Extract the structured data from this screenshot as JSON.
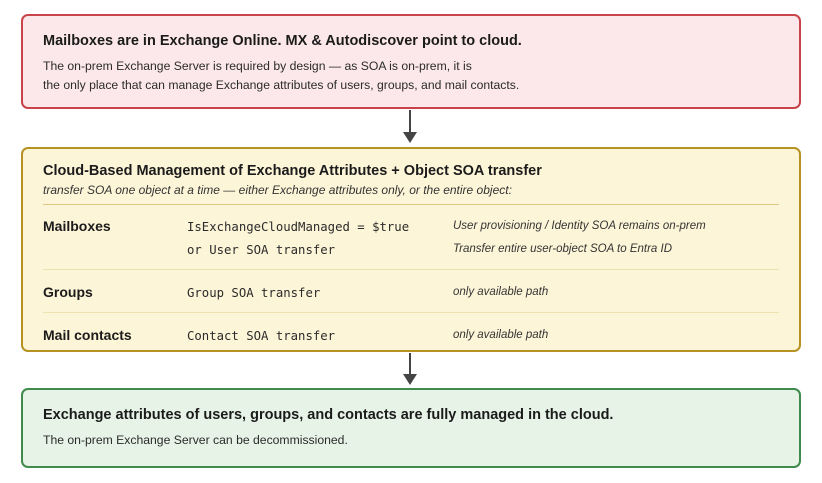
{
  "top_box": {
    "heading": "Mailboxes are in Exchange Online. MX & Autodiscover point to cloud.",
    "body_line1": "The on-prem Exchange Server is required by design — as SOA is on-prem, it is",
    "body_line2": "the only place that can manage Exchange attributes of users, groups, and mail contacts."
  },
  "middle_box": {
    "heading": "Cloud-Based Management of Exchange Attributes + Object SOA transfer",
    "subtitle": "transfer SOA one object at a time — either Exchange attributes only, or the entire object:",
    "rows": [
      {
        "label": "Mailboxes",
        "code_line1": "IsExchangeCloudManaged = $true",
        "code_line2": "or User SOA transfer",
        "note_line1": "User provisioning / Identity SOA remains on-prem",
        "note_line2": "Transfer entire user-object SOA to Entra ID"
      },
      {
        "label": "Groups",
        "code": "Group SOA transfer",
        "note": "only available path"
      },
      {
        "label": "Mail contacts",
        "code": "Contact SOA transfer",
        "note": "only available path"
      }
    ]
  },
  "bottom_box": {
    "heading": "Exchange attributes of users, groups, and contacts are fully managed in the cloud.",
    "body": "The on-prem Exchange Server can be decommissioned."
  },
  "colors": {
    "top_fill": "#fce8ea",
    "top_border": "#c9434b",
    "middle_fill": "#fdf5d8",
    "middle_border": "#b59222",
    "bottom_fill": "#e6f3e6",
    "bottom_border": "#3f8a4c",
    "arrow": "#444444"
  }
}
